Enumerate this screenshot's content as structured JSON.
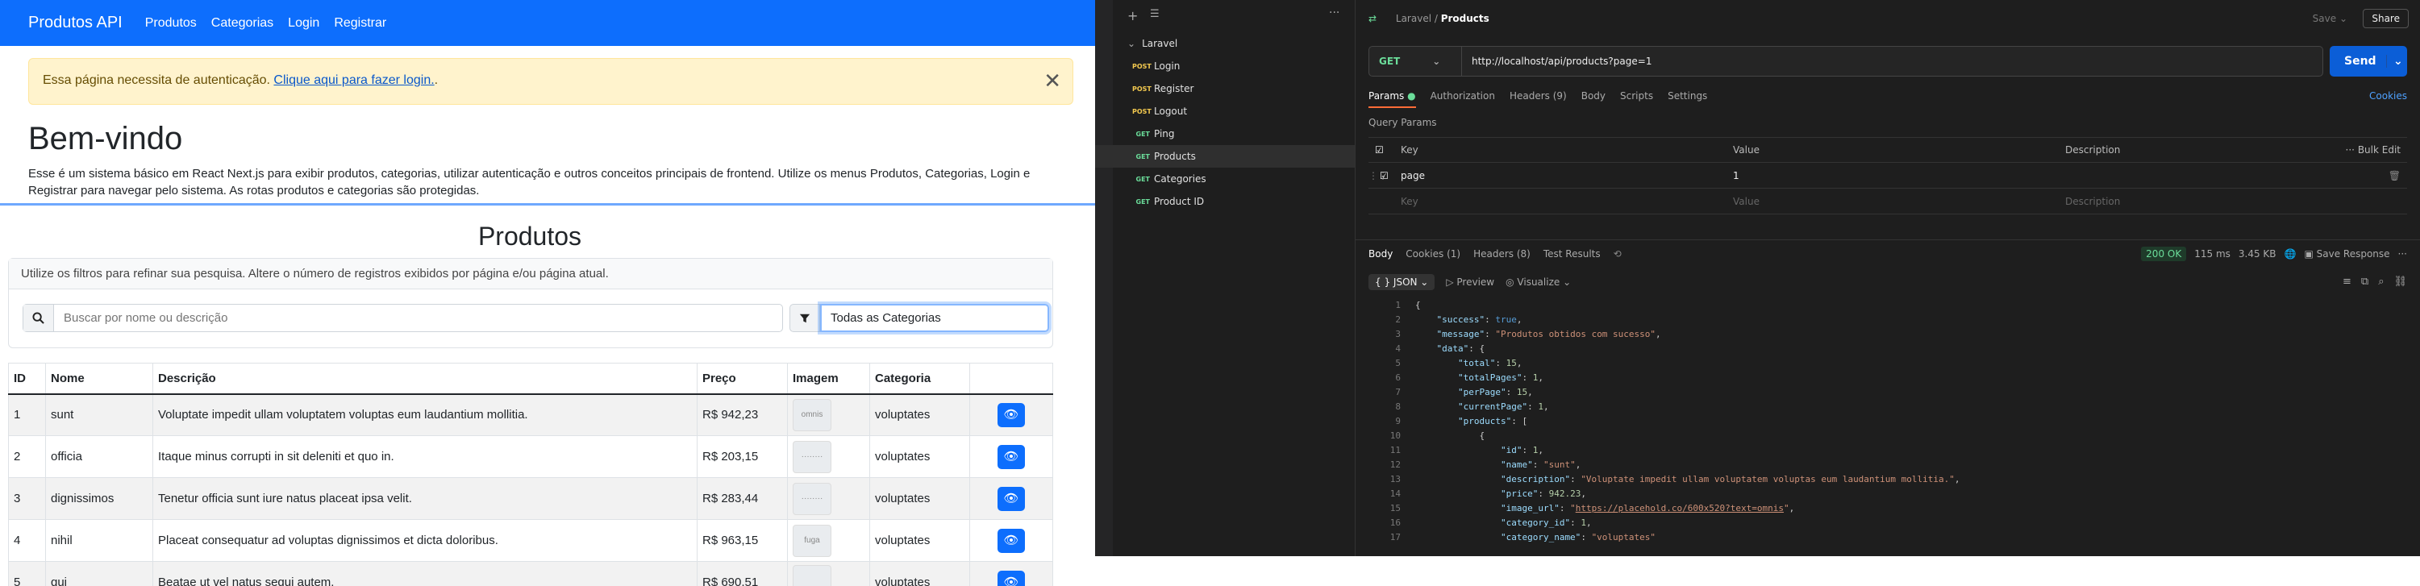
{
  "app": {
    "brand": "Produtos API",
    "nav": [
      "Produtos",
      "Categorias",
      "Login",
      "Registrar"
    ]
  },
  "alert": {
    "text": "Essa página necessita de autenticação.",
    "link": "Clique aqui para fazer login.",
    "after": "."
  },
  "hero": {
    "title": "Bem-vindo",
    "lead": "Esse é um sistema básico em React Next.js para exibir produtos, categorias, utilizar autenticação e outros conceitos principais de frontend. Utilize os menus Produtos, Categorias, Login e Registrar para navegar pelo sistema. As rotas produtos e categorias são protegidas."
  },
  "products": {
    "title": "Produtos",
    "filter_hint": "Utilize os filtros para refinar sua pesquisa. Altere o número de registros exibidos por página e/ou página atual.",
    "search_placeholder": "Buscar por nome ou descrição",
    "category_selected": "Todas as Categorias",
    "columns": [
      "ID",
      "Nome",
      "Descrição",
      "Preço",
      "Imagem",
      "Categoria"
    ],
    "rows": [
      {
        "id": "1",
        "name": "sunt",
        "desc": "Voluptate impedit ullam voluptatem voluptas eum laudantium mollitia.",
        "price": "R$ 942,23",
        "img": "omnis",
        "cat": "voluptates"
      },
      {
        "id": "2",
        "name": "officia",
        "desc": "Itaque minus corrupti in sit deleniti et quo in.",
        "price": "R$ 203,15",
        "img": "········",
        "cat": "voluptates"
      },
      {
        "id": "3",
        "name": "dignissimos",
        "desc": "Tenetur officia sunt iure natus placeat ipsa velit.",
        "price": "R$ 283,44",
        "img": "········",
        "cat": "voluptates"
      },
      {
        "id": "4",
        "name": "nihil",
        "desc": "Placeat consequatur ad voluptas dignissimos et dicta doloribus.",
        "price": "R$ 963,15",
        "img": "fuga",
        "cat": "voluptates"
      },
      {
        "id": "5",
        "name": "qui",
        "desc": "Beatae ut vel natus sequi autem.",
        "price": "R$ 690,51",
        "img": "",
        "cat": "voluptates"
      }
    ]
  },
  "postman": {
    "breadcrumb": [
      "Laravel",
      "Products"
    ],
    "save": "Save",
    "share": "Share",
    "collection": "Laravel",
    "requests": [
      {
        "m": "POST",
        "name": "Login"
      },
      {
        "m": "POST",
        "name": "Register"
      },
      {
        "m": "POST",
        "name": "Logout"
      },
      {
        "m": "GET",
        "name": "Ping"
      },
      {
        "m": "GET",
        "name": "Products"
      },
      {
        "m": "GET",
        "name": "Categories"
      },
      {
        "m": "GET",
        "name": "Product ID"
      }
    ],
    "method": "GET",
    "url": "http://localhost/api/products?page=1",
    "send": "Send",
    "req_tabs": [
      "Params",
      "Authorization",
      "Headers (9)",
      "Body",
      "Scripts",
      "Settings"
    ],
    "cookies": "Cookies",
    "query_params_label": "Query Params",
    "kv_headers": [
      "Key",
      "Value",
      "Description"
    ],
    "bulk_edit": "Bulk Edit",
    "param": {
      "key": "page",
      "value": "1"
    },
    "placeholders": {
      "key": "Key",
      "value": "Value",
      "desc": "Description"
    },
    "res_tabs": [
      "Body",
      "Cookies (1)",
      "Headers (8)",
      "Test Results"
    ],
    "status": "200 OK",
    "time": "115 ms",
    "size": "3.45 KB",
    "save_response": "Save Response",
    "format": "JSON",
    "preview": "Preview",
    "visualize": "Visualize"
  }
}
